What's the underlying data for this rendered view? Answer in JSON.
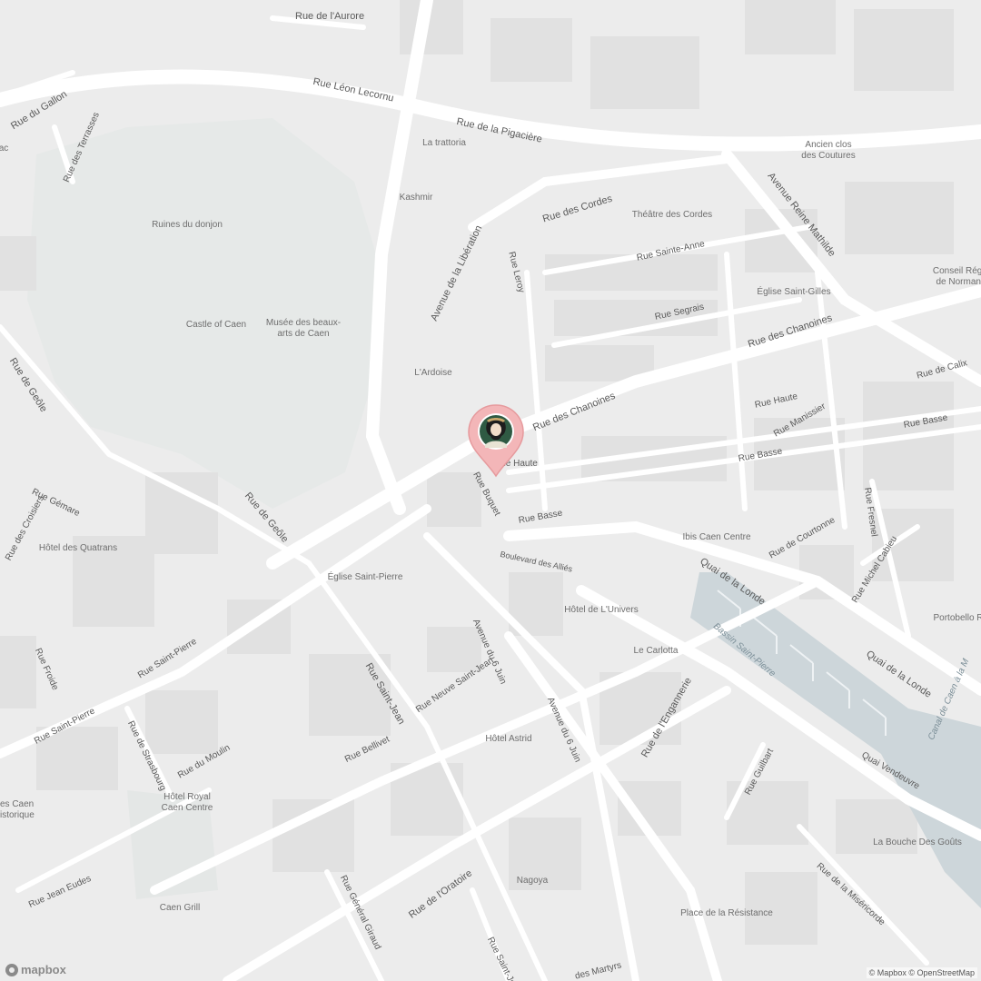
{
  "map": {
    "streets": {
      "aurore": "Rue de l'Aurore",
      "gallon": "Rue du Gallon",
      "lecornu": "Rue Léon Lecornu",
      "pigaciere": "Rue de la Pigacière",
      "terrasses": "Rue des Terrasses",
      "cordes": "Rue des Cordes",
      "liberation": "Avenue de la Libération",
      "leroy": "Rue Leroy",
      "sainte_anne": "Rue Sainte-Anne",
      "reine_mathilde": "Avenue Reine Mathilde",
      "segrais": "Rue Segrais",
      "chanoines_east": "Rue des Chanoines",
      "chanoines": "Rue des Chanoines",
      "calix": "Rue de Calix",
      "haute_east": "Rue Haute",
      "manissier": "Rue Manissier",
      "basse_far": "Rue Basse",
      "basse_mid": "Rue Basse",
      "haute_west": "Rue Haute",
      "buquet": "Rue Buquet",
      "basse_west": "Rue Basse",
      "geole_nw": "Rue de Geôle",
      "geole": "Rue de Geôle",
      "gemare": "Rue Gémare",
      "croisiers": "Rue des Croisiers",
      "allies": "Boulevard des Alliés",
      "courtonne": "Rue de Courtonne",
      "quai_londe_1": "Quai de la Londe",
      "quai_londe_2": "Quai de la Londe",
      "michel_cabieu": "Rue Michel Cabieu",
      "fresnel": "Rue Fresnel",
      "saint_pierre_1": "Rue Saint-Pierre",
      "saint_pierre_2": "Rue Saint-Pierre",
      "froide": "Rue Froide",
      "saint_jean": "Rue Saint-Jean",
      "neuve_saint_jean": "Rue Neuve Saint-Jean",
      "six_juin_1": "Avenue du 6 Juin",
      "six_juin_2": "Avenue du 6 Juin",
      "enganerie": "Rue de l'Engannerie",
      "bellivet": "Rue Bellivet",
      "strasbourg": "Rue de Strasbourg",
      "moulin": "Rue du Moulin",
      "gulbart": "Rue Guilbart",
      "vendeuvre": "Quai Vendeuvre",
      "jean_eudes": "Rue Jean Eudes",
      "general_giraud": "Rue Général Giraud",
      "oratoire": "Rue de l'Oratoire",
      "saint_je": "Rue Saint-Je",
      "martyrs": "des Martyrs",
      "misericorde": "Rue de la Miséricorde",
      "canal": "Canal de Caen à la M"
    },
    "pois": {
      "trattoria": "La trattoria",
      "couture": "Ancien clos\ndes Coutures",
      "kashmir": "Kashmir",
      "theatre": "Théâtre des Cordes",
      "donjon": "Ruines du donjon",
      "conseil": "Conseil Régio\nde Normand",
      "eglise_gilles": "Église Saint-Gilles",
      "castle": "Castle of Caen",
      "musee": "Musée des beaux-\narts de Caen",
      "ardoise": "L'Ardoise",
      "ac": "ac",
      "quatrans": "Hôtel des Quatrans",
      "eglise_pierre": "Église Saint-Pierre",
      "ibis": "Ibis Caen Centre",
      "univers": "Hôtel de L'Univers",
      "portobello": "Portobello R",
      "carlotta": "Le Carlotta",
      "astrid": "Hôtel Astrid",
      "royal": "Hôtel Royal\nCaen Centre",
      "caen_hist": "es Caen\nistorique",
      "bouche": "La Bouche Des Goûts",
      "nagoya": "Nagoya",
      "resistance": "Place de la Résistance",
      "caen_grill": "Caen Grill"
    },
    "water_label": "Bassin Saint-Pierre",
    "marker": {
      "name": "location-pin",
      "color": "#f3b6b8"
    },
    "attribution": "© Mapbox © OpenStreetMap",
    "logo": "mapbox"
  }
}
